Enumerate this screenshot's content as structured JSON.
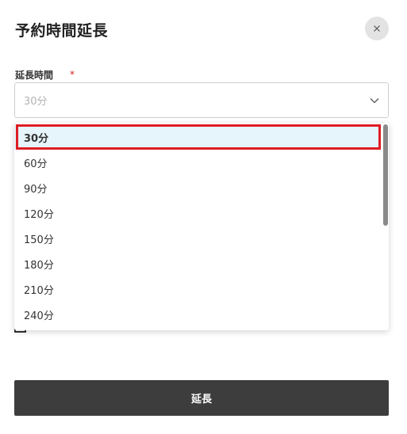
{
  "dialog": {
    "title": "予約時間延長",
    "close_icon": "close-icon"
  },
  "field": {
    "label": "延長時間",
    "required_mark": "*",
    "selected_value": "30分",
    "chevron_icon": "chevron-down-icon"
  },
  "dropdown": {
    "options": [
      "30分",
      "60分",
      "90分",
      "120分",
      "150分",
      "180分",
      "210分",
      "240分"
    ],
    "selected_index": 0
  },
  "submit": {
    "label": "延長"
  },
  "colors": {
    "highlight_border": "#e01c24",
    "selected_bg": "#e6f4fb",
    "button_bg": "#3d3d3d",
    "required": "#d32020"
  }
}
